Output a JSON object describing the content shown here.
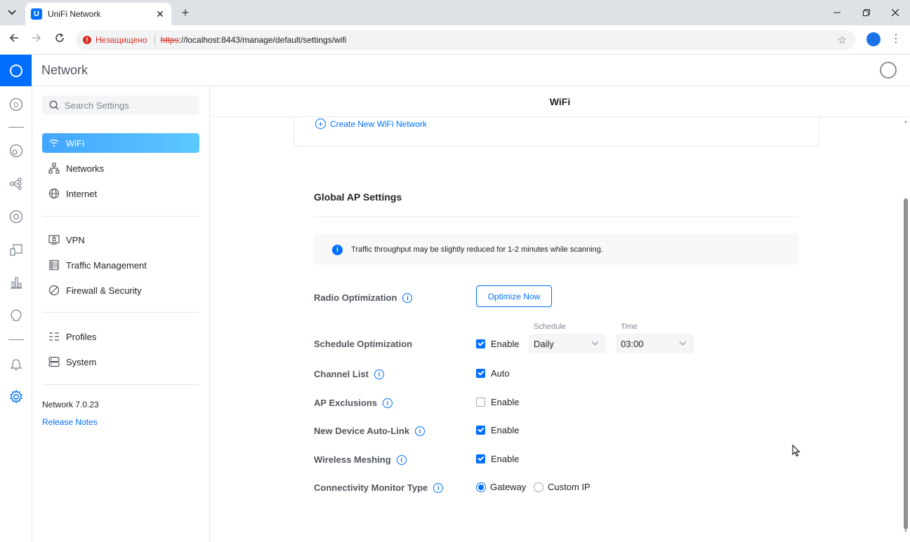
{
  "browser": {
    "tab_title": "UniFi Network",
    "favicon_letter": "U",
    "tab_close": "✕",
    "new_tab": "+",
    "security_label": "Незащищено",
    "url_proto": "https",
    "url_rest": "://localhost:8443/manage/default/settings/wifi",
    "icons": [
      "tab-menu-icon",
      "back-icon",
      "forward-icon",
      "reload-icon",
      "bookmark-star-icon",
      "profile-icon",
      "more-icon",
      "minimize-icon",
      "restore-icon",
      "close-icon"
    ]
  },
  "app": {
    "title": "Network",
    "accent": "#006fff"
  },
  "rail": {
    "items": [
      "dashboard-icon",
      "topology-icon",
      "devices-icon",
      "clients-icon",
      "insights-icon",
      "statistics-icon",
      "alarm-icon",
      "notifications-icon",
      "settings-icon"
    ],
    "dashboard_letter": "D"
  },
  "sidebar": {
    "search_placeholder": "Search Settings",
    "items": [
      {
        "label": "WiFi",
        "icon": "wifi-icon",
        "active": true
      },
      {
        "label": "Networks",
        "icon": "networks-icon"
      },
      {
        "label": "Internet",
        "icon": "globe-icon"
      },
      {
        "label": "VPN",
        "icon": "vpn-icon"
      },
      {
        "label": "Traffic Management",
        "icon": "traffic-icon"
      },
      {
        "label": "Firewall & Security",
        "icon": "shield-icon"
      },
      {
        "label": "Profiles",
        "icon": "profiles-icon"
      },
      {
        "label": "System",
        "icon": "system-icon"
      }
    ],
    "version": "Network 7.0.23",
    "release_notes": "Release Notes"
  },
  "main": {
    "title": "WiFi",
    "create_link": "Create New WiFi Network",
    "section_title": "Global AP Settings",
    "notice": "Traffic throughput may be slightly reduced for 1-2 minutes while scanning.",
    "rows": {
      "radio_optimization": {
        "label": "Radio Optimization",
        "button": "Optimize Now"
      },
      "schedule_optimization": {
        "label": "Schedule Optimization",
        "check": "Enable",
        "checked": true,
        "schedule_label": "Schedule",
        "schedule_value": "Daily",
        "time_label": "Time",
        "time_value": "03:00"
      },
      "channel_list": {
        "label": "Channel List",
        "check": "Auto",
        "checked": true
      },
      "ap_exclusions": {
        "label": "AP Exclusions",
        "check": "Enable",
        "checked": false
      },
      "auto_link": {
        "label": "New Device Auto-Link",
        "check": "Enable",
        "checked": true
      },
      "meshing": {
        "label": "Wireless Meshing",
        "check": "Enable",
        "checked": true
      },
      "connectivity": {
        "label": "Connectivity Monitor Type",
        "option1": "Gateway",
        "option2": "Custom IP",
        "selected": "Gateway"
      }
    },
    "info_glyph": "i"
  }
}
